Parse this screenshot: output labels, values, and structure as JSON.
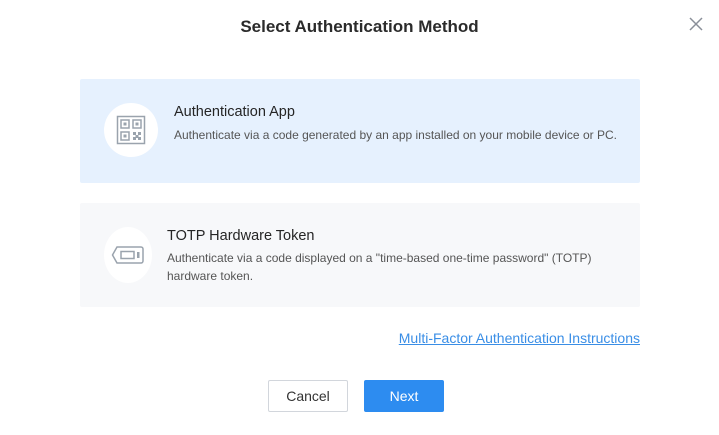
{
  "dialog": {
    "title": "Select Authentication Method"
  },
  "options": [
    {
      "title": "Authentication App",
      "description": "Authenticate via a code generated by an app installed on your mobile device or PC.",
      "icon": "qr-code-icon",
      "selected": true
    },
    {
      "title": "TOTP Hardware Token",
      "description": "Authenticate via a code displayed on a \"time-based one-time password\" (TOTP) hardware token.",
      "icon": "hardware-token-icon",
      "selected": false
    }
  ],
  "help_link": "Multi-Factor Authentication Instructions",
  "buttons": {
    "cancel": "Cancel",
    "next": "Next"
  },
  "colors": {
    "primary": "#2d8cf0",
    "selected_bg": "#e6f1fe",
    "card_bg": "#f7f8fa",
    "link": "#3a8ee6"
  }
}
